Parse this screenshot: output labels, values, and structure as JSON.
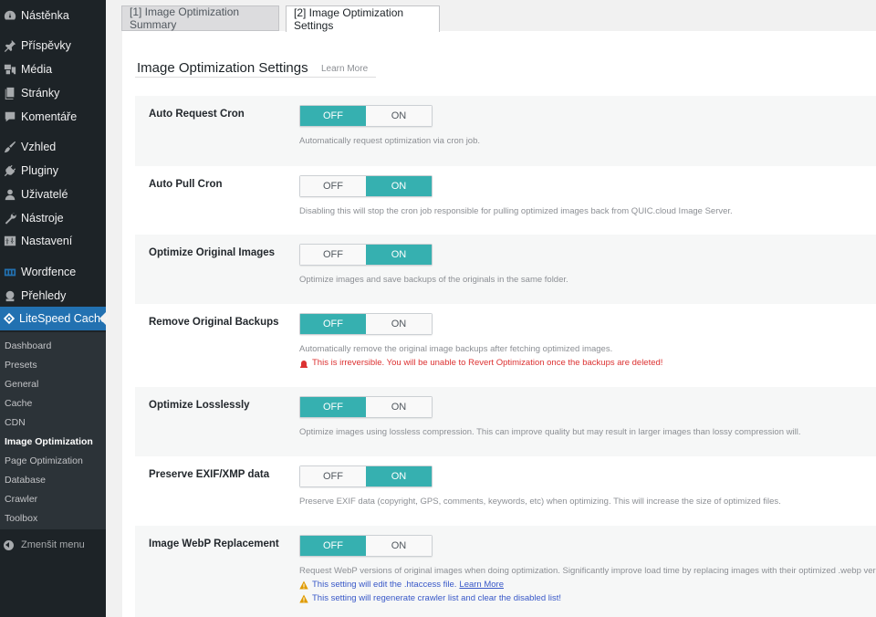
{
  "sidebar": {
    "items": [
      {
        "label": "Nástěnka",
        "icon": "dashboard-icon"
      },
      {
        "label": "Příspěvky",
        "icon": "pin-icon"
      },
      {
        "label": "Média",
        "icon": "media-icon"
      },
      {
        "label": "Stránky",
        "icon": "pages-icon"
      },
      {
        "label": "Komentáře",
        "icon": "comment-icon"
      },
      {
        "label": "Vzhled",
        "icon": "brush-icon"
      },
      {
        "label": "Pluginy",
        "icon": "plugin-icon"
      },
      {
        "label": "Uživatelé",
        "icon": "user-icon"
      },
      {
        "label": "Nástroje",
        "icon": "wrench-icon"
      },
      {
        "label": "Nastavení",
        "icon": "settings-icon"
      },
      {
        "label": "Wordfence",
        "icon": "wordfence-icon"
      },
      {
        "label": "Přehledy",
        "icon": "insights-icon"
      },
      {
        "label": "LiteSpeed Cache",
        "icon": "litespeed-icon",
        "active": true
      }
    ],
    "submenu": [
      "Dashboard",
      "Presets",
      "General",
      "Cache",
      "CDN",
      "Image Optimization",
      "Page Optimization",
      "Database",
      "Crawler",
      "Toolbox"
    ],
    "submenu_current": "Image Optimization",
    "collapse_label": "Zmenšit menu"
  },
  "tabs": [
    {
      "label": "[1] Image Optimization Summary",
      "active": false
    },
    {
      "label": "[2] Image Optimization Settings",
      "active": true
    }
  ],
  "section": {
    "title": "Image Optimization Settings",
    "learn_more": "Learn More"
  },
  "toggle_labels": {
    "off": "OFF",
    "on": "ON"
  },
  "settings": [
    {
      "label": "Auto Request Cron",
      "value": "OFF",
      "description": "Automatically request optimization via cron job."
    },
    {
      "label": "Auto Pull Cron",
      "value": "ON",
      "description": "Disabling this will stop the cron job responsible for pulling optimized images back from QUIC.cloud Image Server."
    },
    {
      "label": "Optimize Original Images",
      "value": "ON",
      "description": "Optimize images and save backups of the originals in the same folder."
    },
    {
      "label": "Remove Original Backups",
      "value": "OFF",
      "description": "Automatically remove the original image backups after fetching optimized images.",
      "warning": "This is irreversible. You will be unable to Revert Optimization once the backups are deleted!"
    },
    {
      "label": "Optimize Losslessly",
      "value": "OFF",
      "description": "Optimize images using lossless compression. This can improve quality but may result in larger images than lossy compression will."
    },
    {
      "label": "Preserve EXIF/XMP data",
      "value": "ON",
      "description": "Preserve EXIF data (copyright, GPS, comments, keywords, etc) when optimizing. This will increase the size of optimized files."
    },
    {
      "label": "Image WebP Replacement",
      "value": "OFF",
      "description": "Request WebP versions of original images when doing optimization. Significantly improve load time by replacing images with their optimized .webp versions.",
      "notes": [
        "This setting will edit the .htaccess file.",
        "This setting will regenerate crawler list and clear the disabled list!"
      ],
      "note_link": "Learn More"
    }
  ],
  "colors": {
    "accent": "#36b0b0",
    "sidebar_bg": "#1d2327",
    "active_menu": "#2271b1",
    "danger": "#dc3232",
    "notice": "#3858c8"
  }
}
